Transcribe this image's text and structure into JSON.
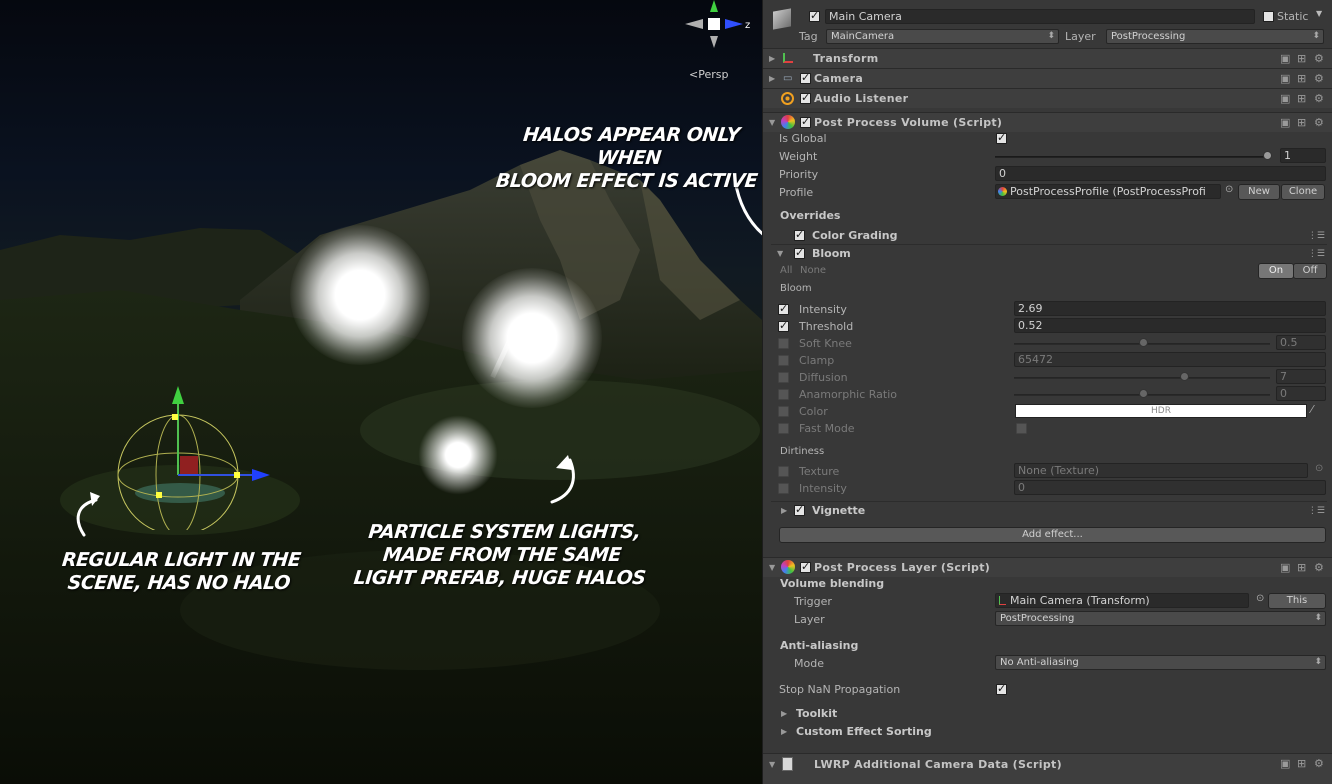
{
  "scene": {
    "view_mode": "Persp",
    "gizmo_axis_label": "z",
    "annotations": {
      "top": [
        "HALOS APPEAR ONLY WHEN",
        "BLOOM EFFECT IS ACTIVE"
      ],
      "left": [
        "REGULAR LIGHT IN THE",
        "SCENE, HAS NO HALO"
      ],
      "middle": [
        "PARTICLE SYSTEM LIGHTS,",
        "MADE FROM THE SAME",
        "LIGHT PREFAB, HUGE HALOS"
      ]
    }
  },
  "inspector": {
    "object": {
      "name": "Main Camera",
      "static_label": "Static",
      "tag_label": "Tag",
      "tag_value": "MainCamera",
      "layer_label": "Layer",
      "layer_value": "PostProcessing"
    },
    "components": {
      "transform": "Transform",
      "camera": "Camera",
      "audio_listener": "Audio Listener",
      "post_volume": "Post Process Volume (Script)",
      "post_layer": "Post Process Layer (Script)",
      "lwrp": "LWRP Additional Camera Data (Script)"
    },
    "volume": {
      "is_global_label": "Is Global",
      "weight_label": "Weight",
      "weight_value": "1",
      "priority_label": "Priority",
      "priority_value": "0",
      "profile_label": "Profile",
      "profile_value": "PostProcessProfile (PostProcessProfi",
      "new_button": "New",
      "clone_button": "Clone",
      "overrides_label": "Overrides",
      "color_grading": "Color Grading",
      "bloom": "Bloom",
      "all_label": "All",
      "none_label": "None",
      "on_label": "On",
      "off_label": "Off",
      "bloom_section": "Bloom",
      "intensity_label": "Intensity",
      "intensity_value": "2.69",
      "threshold_label": "Threshold",
      "threshold_value": "0.52",
      "soft_knee_label": "Soft Knee",
      "soft_knee_value": "0.5",
      "clamp_label": "Clamp",
      "clamp_value": "65472",
      "diffusion_label": "Diffusion",
      "diffusion_value": "7",
      "anamorphic_label": "Anamorphic Ratio",
      "anamorphic_value": "0",
      "color_label": "Color",
      "color_value": "HDR",
      "fast_mode_label": "Fast Mode",
      "dirtiness_section": "Dirtiness",
      "texture_label": "Texture",
      "texture_value": "None (Texture)",
      "dirt_intensity_label": "Intensity",
      "dirt_intensity_value": "0",
      "vignette": "Vignette",
      "add_effect_button": "Add effect..."
    },
    "layer": {
      "volume_blending_label": "Volume blending",
      "trigger_label": "Trigger",
      "trigger_value": "Main Camera (Transform)",
      "this_button": "This",
      "layer_label": "Layer",
      "layer_value": "PostProcessing",
      "anti_aliasing_label": "Anti-aliasing",
      "mode_label": "Mode",
      "mode_value": "No Anti-aliasing",
      "stop_nan_label": "Stop NaN Propagation",
      "toolkit_label": "Toolkit",
      "custom_sorting_label": "Custom Effect Sorting"
    }
  }
}
